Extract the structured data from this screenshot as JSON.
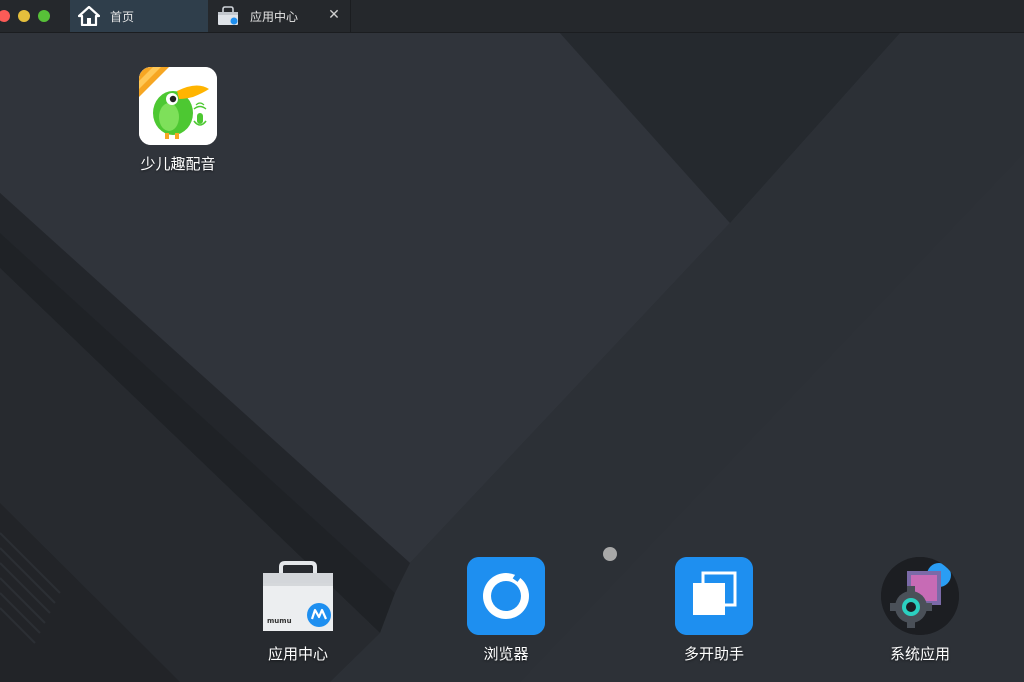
{
  "window": {
    "tabs": [
      {
        "label": "首页",
        "icon": "home-icon",
        "active": true
      },
      {
        "label": "应用中心",
        "icon": "app-store-icon",
        "closable": true
      }
    ],
    "close_symbol": "✕"
  },
  "desktop": {
    "apps": [
      {
        "label": "少儿趣配音",
        "icon": "parrot-app-icon"
      }
    ],
    "page_indicator": {
      "pages": 1,
      "current": 1
    }
  },
  "dock": {
    "items": [
      {
        "label": "应用中心",
        "icon": "app-center-bag-icon"
      },
      {
        "label": "浏览器",
        "icon": "browser-icon"
      },
      {
        "label": "多开助手",
        "icon": "multi-instance-icon"
      },
      {
        "label": "系统应用",
        "icon": "system-apps-icon"
      }
    ]
  },
  "colors": {
    "tab_active_bg": "#2f3e4b",
    "titlebar_bg": "#25282c",
    "wallpaper_base": "#2a2e34",
    "browser_blue": "#1e8ff0"
  }
}
